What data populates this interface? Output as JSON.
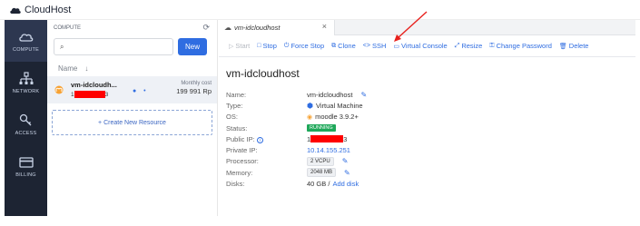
{
  "app": {
    "name": "CloudHost"
  },
  "nav": [
    {
      "label": "COMPUTE",
      "icon": "cloud-icon"
    },
    {
      "label": "NETWORK",
      "icon": "network-icon"
    },
    {
      "label": "ACCESS",
      "icon": "key-icon"
    },
    {
      "label": "BILLING",
      "icon": "card-icon"
    }
  ],
  "left": {
    "heading": "COMPUTE",
    "search_placeholder": "",
    "new_label": "New",
    "col_name": "Name",
    "vm": {
      "name": "vm-idcloudh...",
      "ip_prefix": "1",
      "ip_suffix": "3",
      "cost_label": "Monthly cost",
      "cost_value": "199 991 Rp"
    },
    "create_label": "+ Create New Resource"
  },
  "tab": {
    "label": "vm-idcloudhost"
  },
  "toolbar": {
    "start": "Start",
    "stop": "Stop",
    "force_stop": "Force Stop",
    "clone": "Clone",
    "ssh": "SSH",
    "console": "Virtual Console",
    "resize": "Resize",
    "change_password": "Change Password",
    "delete": "Delete"
  },
  "details": {
    "title": "vm-idcloudhost",
    "rows": {
      "name_label": "Name:",
      "name_value": "vm-idcloudhost",
      "type_label": "Type:",
      "type_value": "Virtual Machine",
      "os_label": "OS:",
      "os_value": "moodle 3.9.2+",
      "status_label": "Status:",
      "status_value": "RUNNING",
      "public_ip_label": "Public IP:",
      "public_ip_prefix": "1",
      "public_ip_suffix": "3",
      "private_ip_label": "Private IP:",
      "private_ip_value": "10.14.155.251",
      "processor_label": "Processor:",
      "processor_value": "2 VCPU",
      "memory_label": "Memory:",
      "memory_value": "2048 MB",
      "disks_label": "Disks:",
      "disks_value": "40 GB /",
      "disks_link": "Add disk"
    }
  },
  "colors": {
    "accent": "#2f6de1",
    "sidebar": "#1d2433",
    "running": "#1fa85a",
    "redaction": "#ff0000",
    "arrow": "#e8201c"
  }
}
